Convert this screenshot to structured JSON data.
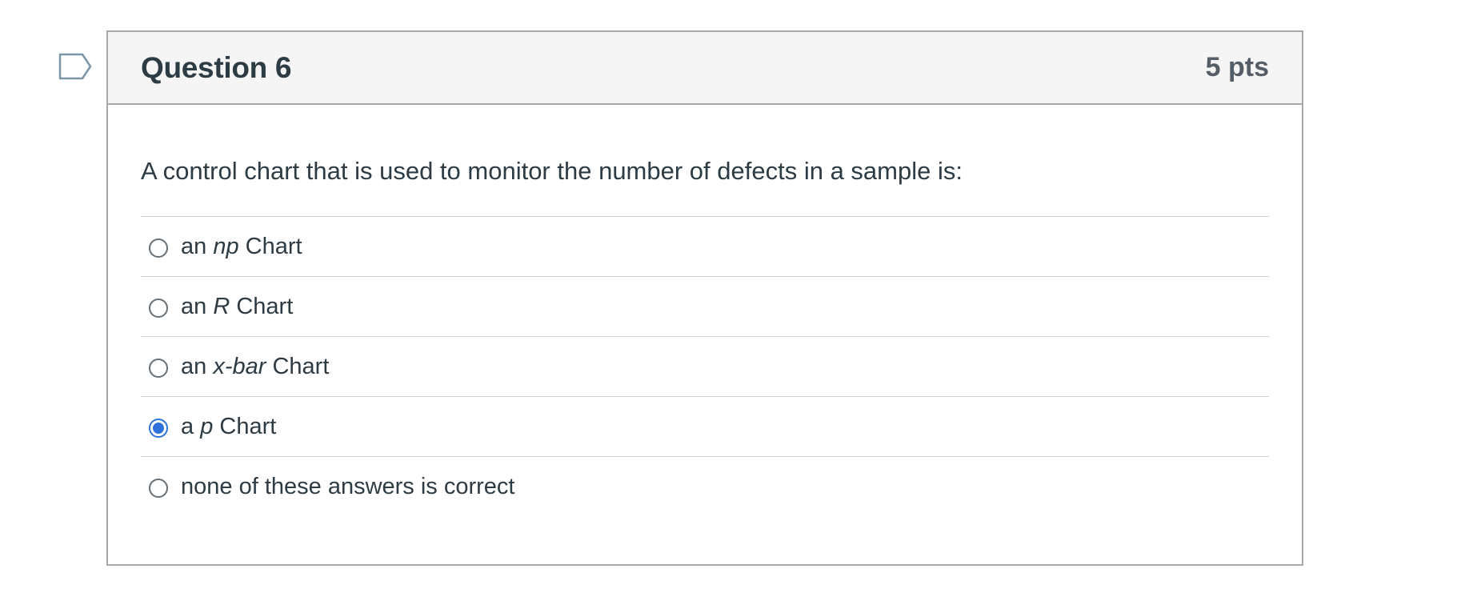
{
  "flag": {
    "icon": "bookmark-flag-icon",
    "color": "#7b95a9"
  },
  "question": {
    "title": "Question 6",
    "points": "5 pts",
    "text": "A control chart that is used to monitor the number of defects in a sample is:",
    "answers": [
      {
        "prefix": "an ",
        "emph": "np",
        "suffix": " Chart",
        "selected": false
      },
      {
        "prefix": "an ",
        "emph": "R",
        "suffix": " Chart",
        "selected": false
      },
      {
        "prefix": "an ",
        "emph": "x-bar",
        "suffix": " Chart",
        "selected": false
      },
      {
        "prefix": "a ",
        "emph": "p",
        "suffix": " Chart",
        "selected": true
      },
      {
        "prefix": "none of these answers is correct",
        "emph": "",
        "suffix": "",
        "selected": false
      }
    ]
  },
  "colors": {
    "accent": "#2d72d9",
    "text": "#2d3b45",
    "header_bg": "#f5f5f5",
    "border": "#a8a8a8"
  }
}
